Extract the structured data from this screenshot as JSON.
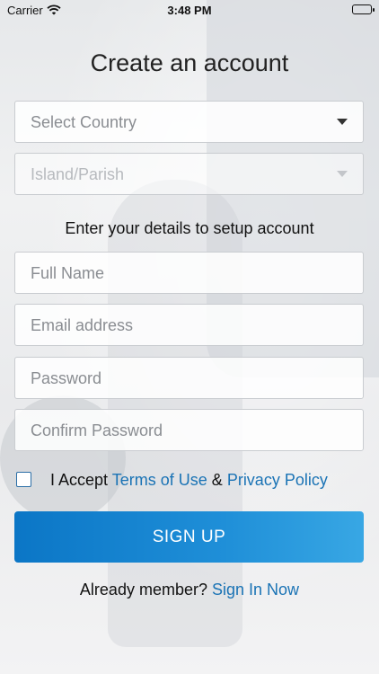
{
  "status_bar": {
    "carrier": "Carrier",
    "time": "3:48 PM",
    "wifi_icon": "wifi-icon",
    "battery_icon": "battery-icon"
  },
  "page": {
    "title": "Create an account"
  },
  "location": {
    "country_placeholder": "Select Country",
    "island_placeholder": "Island/Parish"
  },
  "details": {
    "heading": "Enter your details to setup account",
    "full_name_placeholder": "Full Name",
    "email_placeholder": "Email address",
    "password_placeholder": "Password",
    "confirm_password_placeholder": "Confirm Password"
  },
  "terms": {
    "accept_text": "I Accept",
    "terms_link": "Terms of Use",
    "ampersand": "&",
    "privacy_link": "Privacy Policy",
    "checked": false
  },
  "actions": {
    "signup_label": "SIGN UP",
    "already_member_text": "Already member?",
    "signin_link": "Sign In Now"
  },
  "colors": {
    "accent": "#1a73b5",
    "button_start": "#0b76c6",
    "button_end": "#38a7e4"
  }
}
